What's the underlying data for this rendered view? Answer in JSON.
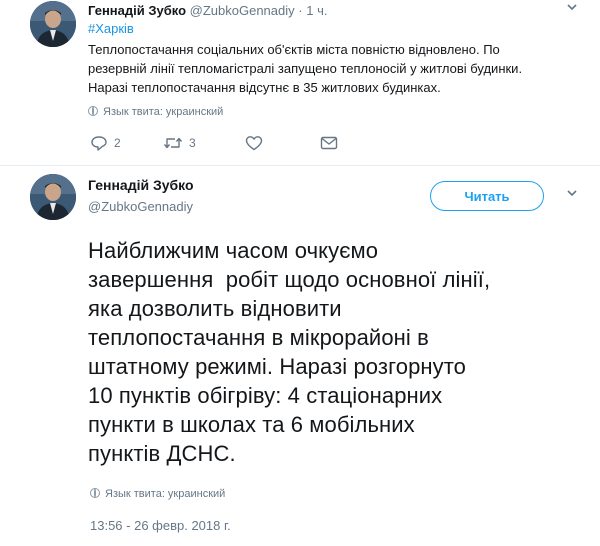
{
  "tweet1": {
    "name": "Геннадій Зубко",
    "handle": "@ZubkoGennadiy",
    "separator": "·",
    "time": "1 ч.",
    "hashtag": "#Харків",
    "text_lines": [
      "Теплопостачання соціальних об'єктів міста повністю відновлено. По",
      "резервній лінії тепломагістралі запущено теплоносій у житлові будинки.",
      "Наразі теплопостачання відсутнє в 35 житлових будинках."
    ],
    "language": "Язык твита: украинский",
    "replies": "2",
    "retweets": "3"
  },
  "tweet2": {
    "name": "Геннадій Зубко",
    "handle": "@ZubkoGennadiy",
    "follow_label": "Читать",
    "text_lines": [
      "Найближчим часом очкуємо",
      "завершення  робіт щодо основної лінії,",
      "яка дозволить відновити",
      "теплопостачання в мікрорайоні в",
      "штатному режимі. Наразі розгорнуто",
      "10 пунктів обігріву: 4 стаціонарних",
      "пункти в школах та 6 мобільних",
      "пунктів ДСНС."
    ],
    "language": "Язык твита: украинский",
    "timestamp": "13:56 - 26 февр. 2018 г."
  },
  "colors": {
    "accent": "#1da1f2",
    "link": "#1b95e0",
    "muted": "#657786",
    "text": "#14171a"
  },
  "icons": [
    "reply-icon",
    "retweet-icon",
    "like-icon",
    "direct-message-icon",
    "globe-icon",
    "chevron-down-icon"
  ]
}
